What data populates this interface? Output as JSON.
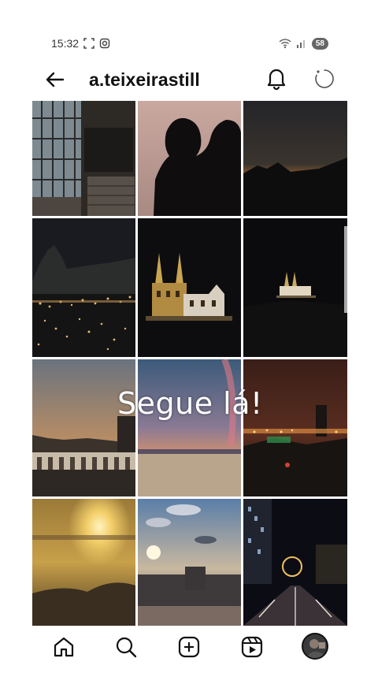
{
  "status": {
    "time": "15:32",
    "battery": "58"
  },
  "header": {
    "username": "a.teixeirastill"
  },
  "overlay": {
    "text": "Segue lá!"
  },
  "icons": {
    "back": "arrow-left-icon",
    "bell": "bell-icon",
    "loading": "loading-spinner-icon",
    "home": "home-icon",
    "search": "search-icon",
    "create": "plus-square-icon",
    "reels": "reels-icon",
    "profile": "avatar"
  }
}
